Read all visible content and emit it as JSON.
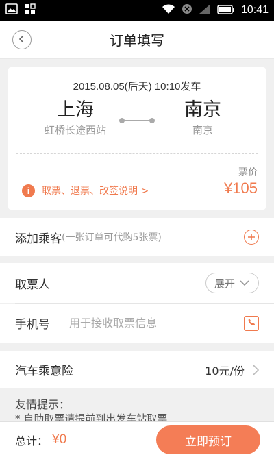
{
  "status_bar": {
    "time": "10:41",
    "icons": [
      "image-icon",
      "app-icon",
      "wifi-icon",
      "mute-icon",
      "signal-icon",
      "battery-icon"
    ]
  },
  "nav": {
    "title": "订单填写"
  },
  "ticket": {
    "date_line": "2015.08.05(后天)   10:10发车",
    "from_city": "上海",
    "from_station": "虹桥长途西站",
    "to_city": "南京",
    "to_station": "南京",
    "info_link": "取票、退票、改签说明 >",
    "price_label": "票价",
    "price_value": "¥105"
  },
  "passenger": {
    "label": "添加乘客",
    "hint": "(一张订单可代购5张票)"
  },
  "pickup": {
    "label": "取票人",
    "expand_label": "展开"
  },
  "phone": {
    "label": "手机号",
    "placeholder": "用于接收取票信息",
    "value": ""
  },
  "insurance": {
    "label": "汽车乘意险",
    "value": "10元/份"
  },
  "tips": {
    "title": "友情提示：",
    "line1": "* 自助取票请提前到出发车站取票"
  },
  "footer": {
    "total_label": "总计：",
    "total_value": "¥0",
    "submit_label": "立即预订"
  },
  "colors": {
    "accent": "#f07a4e",
    "background": "#f0f0f0"
  }
}
